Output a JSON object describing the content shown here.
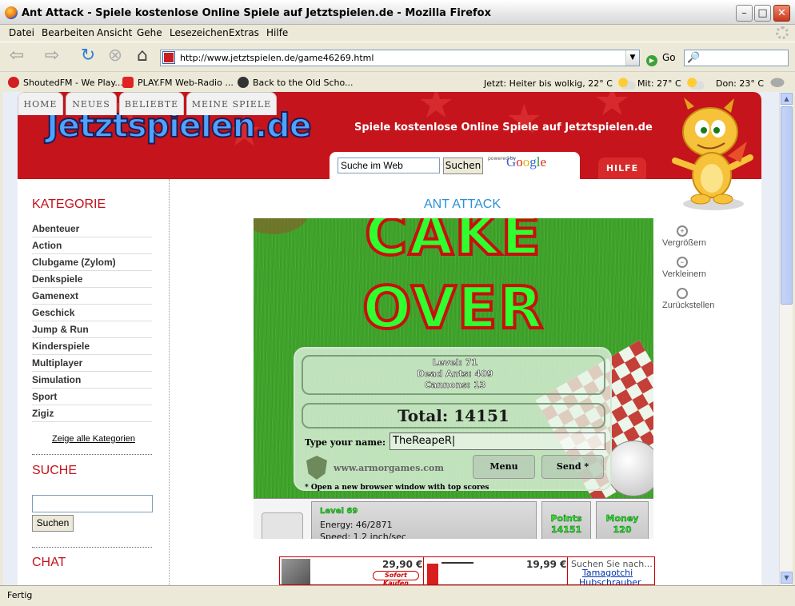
{
  "window": {
    "title": "Ant Attack - Spiele kostenlose Online Spiele auf Jetztspielen.de - Mozilla Firefox"
  },
  "menu": [
    "Datei",
    "Bearbeiten",
    "Ansicht",
    "Gehe",
    "Lesezeichen",
    "Extras",
    "Hilfe"
  ],
  "nav": {
    "url": "http://www.jetztspielen.de/game46269.html",
    "go_label": "Go"
  },
  "bookmarks": [
    "ShoutedFM - We Play...",
    "PLAY.FM  Web-Radio ...",
    "Back to the Old Scho..."
  ],
  "weather": [
    {
      "label": "Jetzt: Heiter bis wolkig, 22° C"
    },
    {
      "label": "Mit: 27° C"
    },
    {
      "label": "Don: 23° C"
    }
  ],
  "site": {
    "logo": "Jetztspielen.de",
    "tagline": "Spiele kostenlose Online Spiele auf Jetztspielen.de",
    "tabs": [
      "HOME",
      "NEUES",
      "BELIEBTE",
      "MEINE SPIELE"
    ],
    "search": {
      "value": "Suche im Web",
      "button": "Suchen",
      "powered": "powered by",
      "google": "Google"
    },
    "help": "HILFE"
  },
  "sidebar": {
    "category_title": "KATEGORIE",
    "categories": [
      "Abenteuer",
      "Action",
      "Clubgame (Zylom)",
      "Denkspiele",
      "Gamenext",
      "Geschick",
      "Jump & Run",
      "Kinderspiele",
      "Multiplayer",
      "Simulation",
      "Sport",
      "Zigiz"
    ],
    "show_all": "Zeige alle Kategorien",
    "search_title": "SUCHE",
    "search_button": "Suchen",
    "chat_title": "CHAT"
  },
  "game": {
    "title": "ANT ATTACK",
    "line1": "CAKE",
    "line2": "OVER",
    "level": "Level: 71",
    "dead_ants": "Dead Ants: 409",
    "cannons": "Cannons: 13",
    "total": "Total: 14151",
    "name_label": "Type your name:",
    "name_value": "TheReapeR|",
    "site": "www.armorgames.com",
    "menu_btn": "Menu",
    "send_btn": "Send *",
    "footnote": "* Open a new browser window with top scores",
    "hud": {
      "level": "Level 69",
      "energy": "Energy: 46/2871",
      "speed": "Speed: 1.2 inch/sec",
      "points_label": "Points",
      "points_value": "14151",
      "money_label": "Money",
      "money_value": "120"
    }
  },
  "zoom": [
    "Vergrößern",
    "Verkleinern",
    "Zurückstellen"
  ],
  "ad": {
    "price1": "29,90 €",
    "sofort": "Sofort Kaufen",
    "price2": "19,99 €",
    "suche": "Suchen Sie nach...",
    "link1": "Tamagotchi",
    "link2": "Hubschrauber"
  },
  "status": "Fertig"
}
